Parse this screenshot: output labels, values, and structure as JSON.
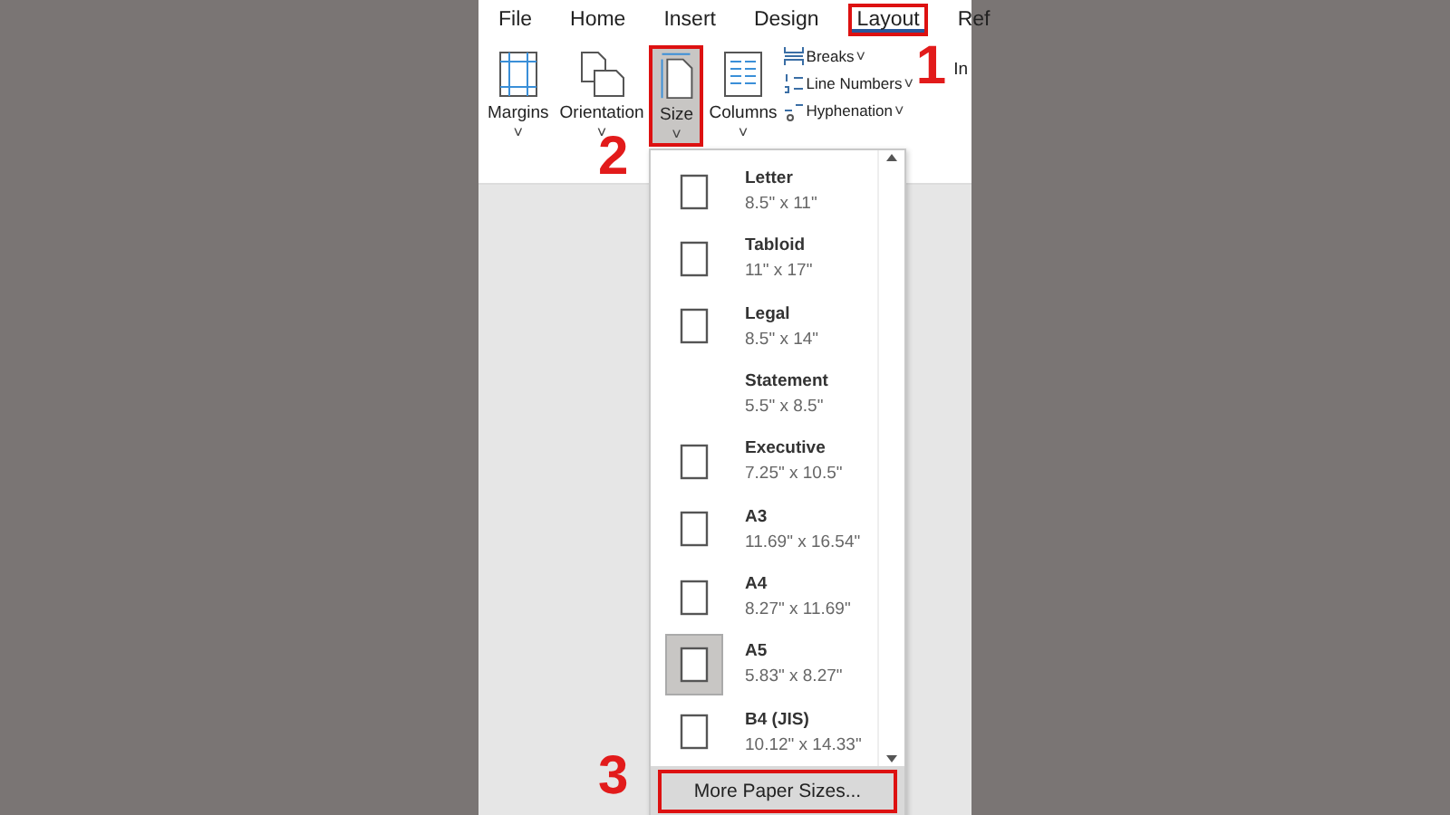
{
  "tabs": [
    {
      "label": "File",
      "selected": false
    },
    {
      "label": "Home",
      "selected": false
    },
    {
      "label": "Insert",
      "selected": false
    },
    {
      "label": "Design",
      "selected": false
    },
    {
      "label": "Layout",
      "selected": true
    },
    {
      "label": "Ref",
      "selected": false
    }
  ],
  "ribbon": {
    "large_buttons": [
      {
        "label": "Margins",
        "caret": "˅",
        "selected": false
      },
      {
        "label": "Orientation",
        "caret": "˅",
        "selected": false
      },
      {
        "label": "Size",
        "caret": "˅",
        "selected": true
      },
      {
        "label": "Columns",
        "caret": "˅",
        "selected": false
      }
    ],
    "small_buttons": [
      {
        "label": "Breaks",
        "caret": "˅"
      },
      {
        "label": "Line Numbers",
        "caret": "˅"
      },
      {
        "label": "Hyphenation",
        "caret": "˅"
      }
    ],
    "cut_label": "In"
  },
  "size_menu": {
    "items": [
      {
        "name": "Letter",
        "dimensions": "8.5\" x 11\"",
        "kind": "page",
        "selected": false
      },
      {
        "name": "Tabloid",
        "dimensions": "11\" x 17\"",
        "kind": "page",
        "selected": false
      },
      {
        "name": "Legal",
        "dimensions": "8.5\" x 14\"",
        "kind": "page",
        "selected": false
      },
      {
        "name": "Statement",
        "dimensions": "5.5\" x 8.5\"",
        "kind": "blank",
        "selected": false
      },
      {
        "name": "Executive",
        "dimensions": "7.25\" x 10.5\"",
        "kind": "page",
        "selected": false
      },
      {
        "name": "A3",
        "dimensions": "11.69\" x 16.54\"",
        "kind": "page",
        "selected": false
      },
      {
        "name": "A4",
        "dimensions": "8.27\" x 11.69\"",
        "kind": "page",
        "selected": false
      },
      {
        "name": "A5",
        "dimensions": "5.83\" x 8.27\"",
        "kind": "page",
        "selected": true
      },
      {
        "name": "B4 (JIS)",
        "dimensions": "10.12\" x 14.33\"",
        "kind": "page",
        "selected": false
      }
    ],
    "footer_button": "More Paper Sizes..."
  },
  "step_numbers": [
    "1",
    "2",
    "3"
  ]
}
